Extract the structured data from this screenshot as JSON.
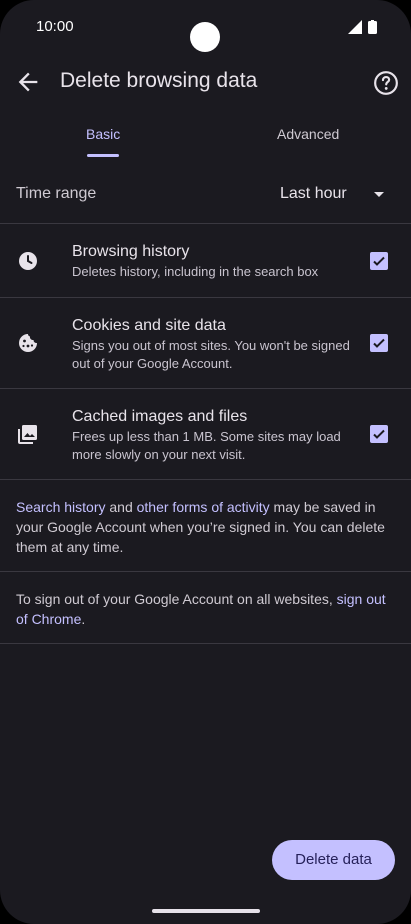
{
  "status_bar": {
    "time": "10:00"
  },
  "app_bar": {
    "title": "Delete browsing data"
  },
  "tabs": [
    {
      "label": "Basic",
      "selected": true
    },
    {
      "label": "Advanced",
      "selected": false
    }
  ],
  "time_range": {
    "label": "Time range",
    "value": "Last hour"
  },
  "options": [
    {
      "title": "Browsing history",
      "description": "Deletes history, including in the search box",
      "checked": true,
      "icon": "clock-icon"
    },
    {
      "title": "Cookies and site data",
      "description": "Signs you out of most sites. You won't be signed out of your Google Account.",
      "checked": true,
      "icon": "cookie-icon"
    },
    {
      "title": "Cached images and files",
      "description": "Frees up less than 1 MB. Some sites may load more slowly on your next visit.",
      "checked": true,
      "icon": "image-icon"
    }
  ],
  "info1": {
    "link1": "Search history",
    "text1": " and ",
    "link2": "other forms of activity",
    "text2": " may be saved in your Google Account when you’re signed in. You can delete them at any time."
  },
  "info2": {
    "text1": "To sign out of your Google Account on all websites, ",
    "link": "sign out of Chrome",
    "text2": "."
  },
  "delete_button": {
    "label": "Delete data"
  },
  "colors": {
    "background": "#1b1a20",
    "accent": "#c4c0ff",
    "divider": "#3a3840"
  }
}
